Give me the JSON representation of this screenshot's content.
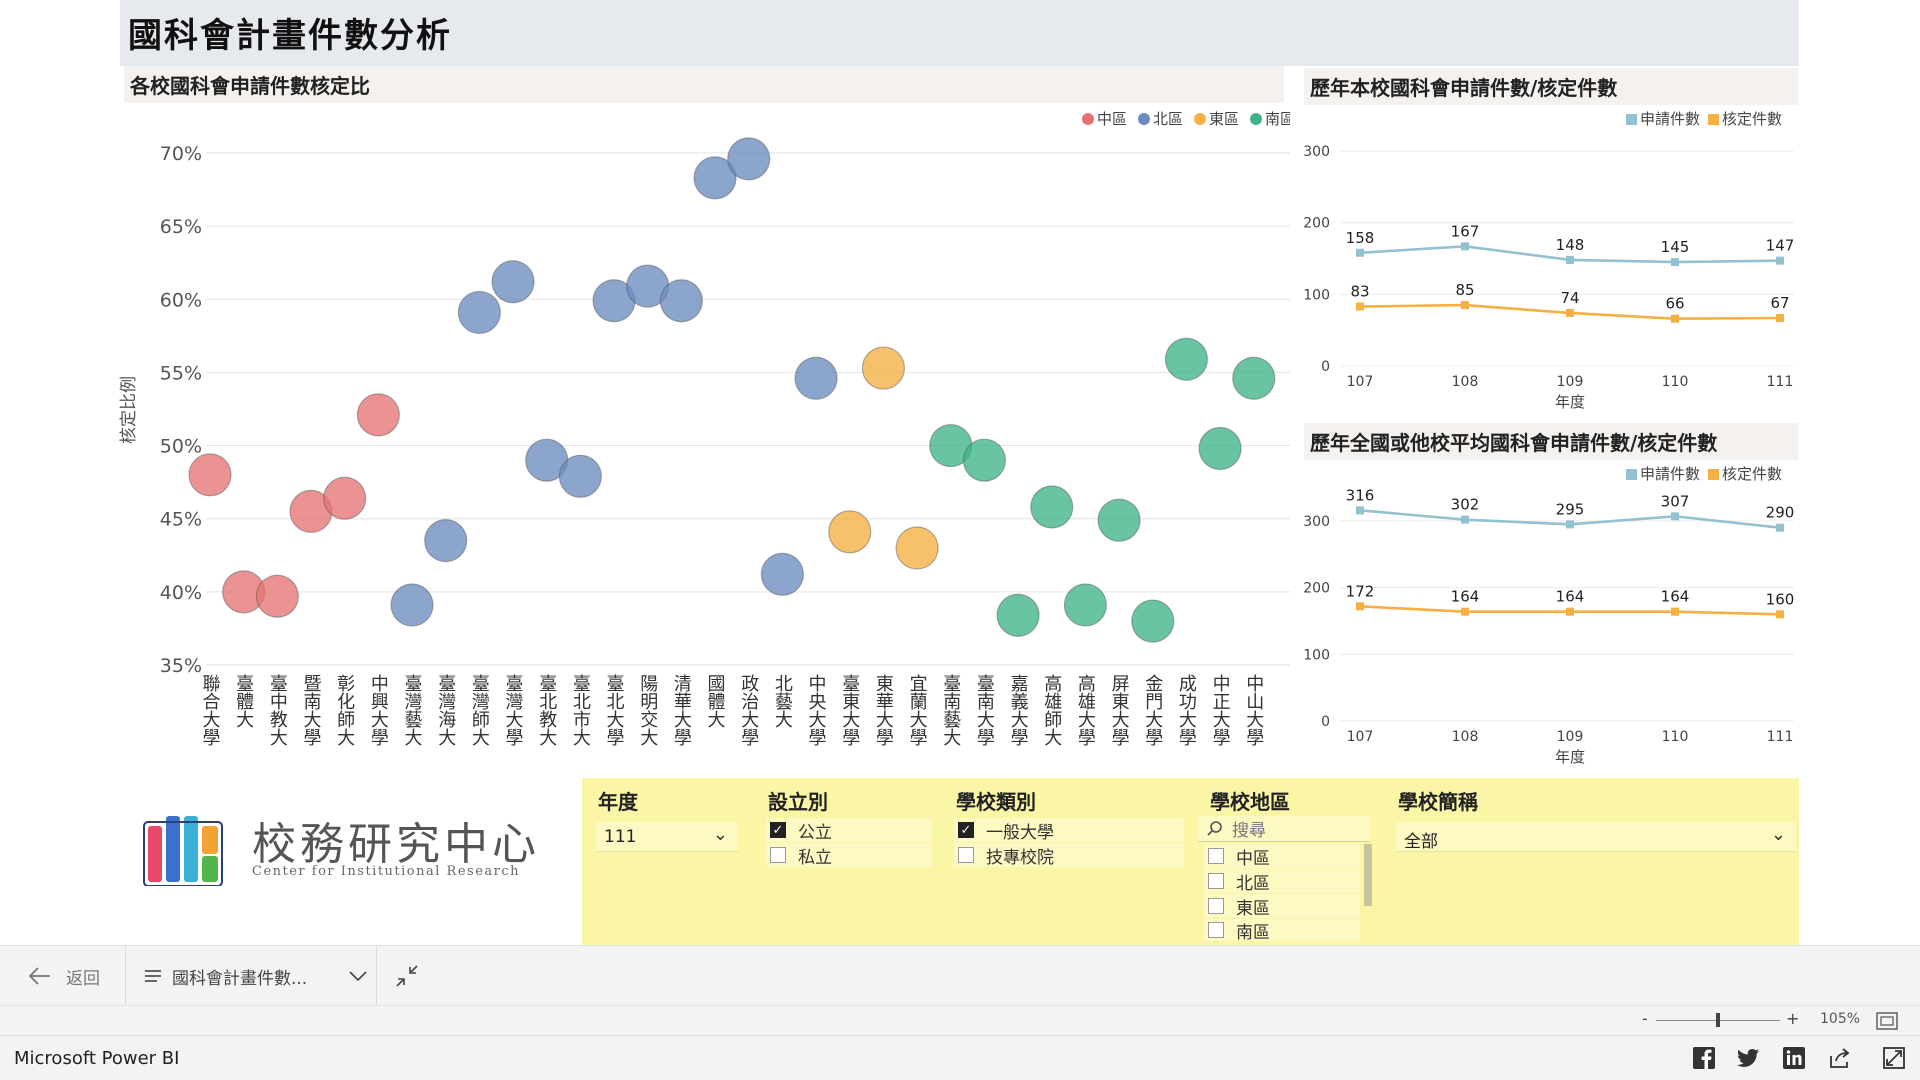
{
  "page_title": "國科會計畫件數分析",
  "bubble_panel": {
    "title": "各校國科會申請件數核定比",
    "ylabel": "核定比例"
  },
  "region_colors": {
    "中區": "#e57373",
    "北區": "#6b8cbf",
    "東區": "#f5b041",
    "南區": "#3fb386"
  },
  "line_panel_1": {
    "title": "歷年本校國科會申請件數/核定件數",
    "xlabel": "年度"
  },
  "line_panel_2": {
    "title": "歷年全國或他校平均國科會申請件數/核定件數",
    "xlabel": "年度"
  },
  "chart_data": [
    {
      "type": "scatter",
      "title": "各校國科會申請件數核定比",
      "ylabel": "核定比例",
      "ylim": [
        35,
        70
      ],
      "yticks": [
        "35%",
        "40%",
        "45%",
        "50%",
        "55%",
        "60%",
        "65%",
        "70%"
      ],
      "legend": [
        "中區",
        "北區",
        "東區",
        "南區"
      ],
      "legend_position": "top-right",
      "grid": true,
      "points": [
        {
          "school": "聯合大學",
          "region": "中區",
          "value": 48.0
        },
        {
          "school": "臺體大",
          "region": "中區",
          "value": 40.0
        },
        {
          "school": "臺中教大",
          "region": "中區",
          "value": 39.7
        },
        {
          "school": "暨南大學",
          "region": "中區",
          "value": 45.5
        },
        {
          "school": "彰化師大",
          "region": "中區",
          "value": 46.4
        },
        {
          "school": "中興大學",
          "region": "中區",
          "value": 52.1
        },
        {
          "school": "臺灣藝大",
          "region": "北區",
          "value": 39.1
        },
        {
          "school": "臺灣海大",
          "region": "北區",
          "value": 43.5
        },
        {
          "school": "臺灣師大",
          "region": "北區",
          "value": 59.1
        },
        {
          "school": "臺灣大學",
          "region": "北區",
          "value": 61.2
        },
        {
          "school": "臺北教大",
          "region": "北區",
          "value": 49.0
        },
        {
          "school": "臺北市大",
          "region": "北區",
          "value": 47.9
        },
        {
          "school": "臺北大學",
          "region": "北區",
          "value": 59.9
        },
        {
          "school": "陽明交大",
          "region": "北區",
          "value": 60.9
        },
        {
          "school": "清華大學",
          "region": "北區",
          "value": 59.9
        },
        {
          "school": "國體大",
          "region": "北區",
          "value": 68.3
        },
        {
          "school": "政治大學",
          "region": "北區",
          "value": 69.6
        },
        {
          "school": "北藝大",
          "region": "北區",
          "value": 41.2
        },
        {
          "school": "中央大學",
          "region": "北區",
          "value": 54.6
        },
        {
          "school": "臺東大學",
          "region": "東區",
          "value": 44.1
        },
        {
          "school": "東華大學",
          "region": "東區",
          "value": 55.3
        },
        {
          "school": "宜蘭大學",
          "region": "東區",
          "value": 43.0
        },
        {
          "school": "臺南藝大",
          "region": "南區",
          "value": 50.0
        },
        {
          "school": "臺南大學",
          "region": "南區",
          "value": 49.0
        },
        {
          "school": "嘉義大學",
          "region": "南區",
          "value": 38.4
        },
        {
          "school": "高雄師大",
          "region": "南區",
          "value": 45.8
        },
        {
          "school": "高雄大學",
          "region": "南區",
          "value": 39.1
        },
        {
          "school": "屏東大學",
          "region": "南區",
          "value": 44.9
        },
        {
          "school": "金門大學",
          "region": "南區",
          "value": 38.0
        },
        {
          "school": "成功大學",
          "region": "南區",
          "value": 55.9
        },
        {
          "school": "中正大學",
          "region": "南區",
          "value": 49.8
        },
        {
          "school": "中山大學",
          "region": "南區",
          "value": 54.6
        }
      ]
    },
    {
      "type": "line",
      "title": "歷年本校國科會申請件數/核定件數",
      "xlabel": "年度",
      "x": [
        "107",
        "108",
        "109",
        "110",
        "111"
      ],
      "ylim": [
        0,
        300
      ],
      "yticks": [
        "0",
        "100",
        "200",
        "300"
      ],
      "legend_position": "top-right",
      "series": [
        {
          "name": "申請件數",
          "color": "#92c1cf",
          "values": [
            158,
            167,
            148,
            145,
            147
          ]
        },
        {
          "name": "核定件數",
          "color": "#f5b041",
          "values": [
            83,
            85,
            74,
            66,
            67
          ]
        }
      ]
    },
    {
      "type": "line",
      "title": "歷年全國或他校平均國科會申請件數/核定件數",
      "xlabel": "年度",
      "x": [
        "107",
        "108",
        "109",
        "110",
        "111"
      ],
      "ylim": [
        0,
        300
      ],
      "yticks": [
        "0",
        "100",
        "200",
        "300"
      ],
      "legend_position": "top-right",
      "series": [
        {
          "name": "申請件數",
          "color": "#92c1cf",
          "values": [
            316,
            302,
            295,
            307,
            290
          ]
        },
        {
          "name": "核定件數",
          "color": "#f5b041",
          "values": [
            172,
            164,
            164,
            164,
            160
          ]
        }
      ]
    }
  ],
  "slicers": {
    "year": {
      "title": "年度",
      "value": "111"
    },
    "establishment": {
      "title": "設立別",
      "options": [
        {
          "label": "公立",
          "checked": true
        },
        {
          "label": "私立",
          "checked": false
        }
      ]
    },
    "school_type": {
      "title": "學校類別",
      "options": [
        {
          "label": "一般大學",
          "checked": true
        },
        {
          "label": "技專校院",
          "checked": false
        }
      ]
    },
    "region": {
      "title": "學校地區",
      "search_placeholder": "搜尋",
      "options": [
        {
          "label": "中區",
          "checked": false
        },
        {
          "label": "北區",
          "checked": false
        },
        {
          "label": "東區",
          "checked": false
        },
        {
          "label": "南區",
          "checked": false
        }
      ]
    },
    "school_name": {
      "title": "學校簡稱",
      "value": "全部"
    }
  },
  "logo": {
    "text": "校務研究中心",
    "subtitle": "Center for Institutional Research"
  },
  "nav": {
    "back_label": "返回",
    "page_label": "國科會計畫件數..."
  },
  "zoom": {
    "minus": "-",
    "plus": "+",
    "level": "105%"
  },
  "footer": {
    "brand": "Microsoft Power BI"
  },
  "icons": [
    "arrow-left-icon",
    "hamburger-icon",
    "chevron-down-icon",
    "collapse-icon",
    "fit-page-icon",
    "facebook-icon",
    "twitter-icon",
    "linkedin-icon",
    "share-icon",
    "fullscreen-icon",
    "search-icon"
  ]
}
